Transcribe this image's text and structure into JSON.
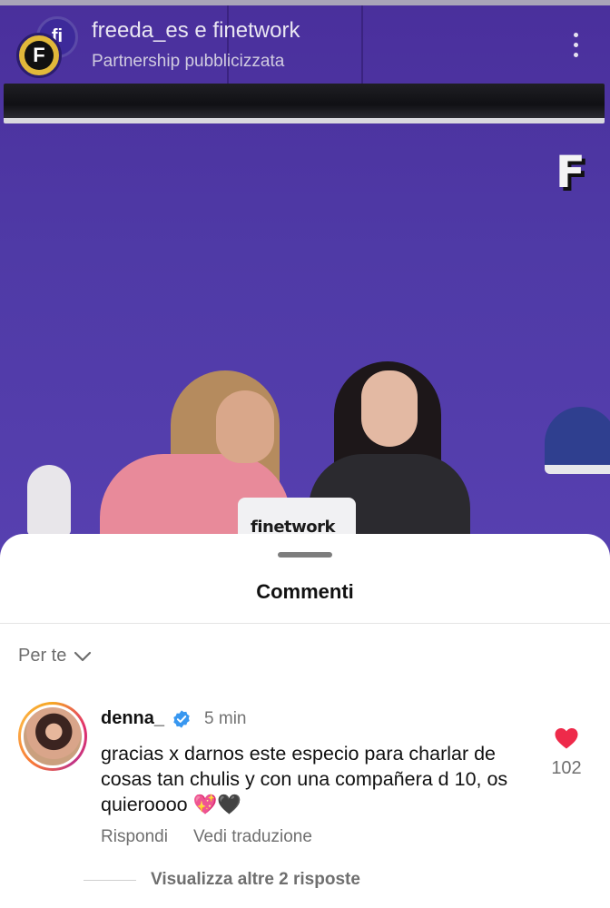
{
  "header": {
    "title": "freeda_es e finetwork",
    "subtitle": "Partnership pubblicizzata",
    "avatar_back_text": "fi",
    "avatar_front_text": "F"
  },
  "video": {
    "wall_logo_text": "F",
    "laptop_text": "finetwork"
  },
  "sheet": {
    "title": "Commenti",
    "filter_label": "Per te"
  },
  "comment": {
    "username": "denna_",
    "verified": true,
    "time": "5 min",
    "text": "gracias x darnos este especio para charlar de cosas tan chulis y con una compañera d 10, os quieroooo 💖🖤",
    "actions": {
      "reply": "Rispondi",
      "translate": "Vedi traduzione"
    },
    "like_count": "102",
    "view_replies": "Visualizza altre 2 risposte"
  },
  "colors": {
    "like": "#ee2a4a",
    "verified": "#3897f0",
    "wall": "#4f3aa6"
  },
  "icons": {
    "menu": "kebab-menu-icon",
    "filter": "chevron-down-icon",
    "verified": "verified-badge-icon",
    "like": "heart-icon"
  }
}
